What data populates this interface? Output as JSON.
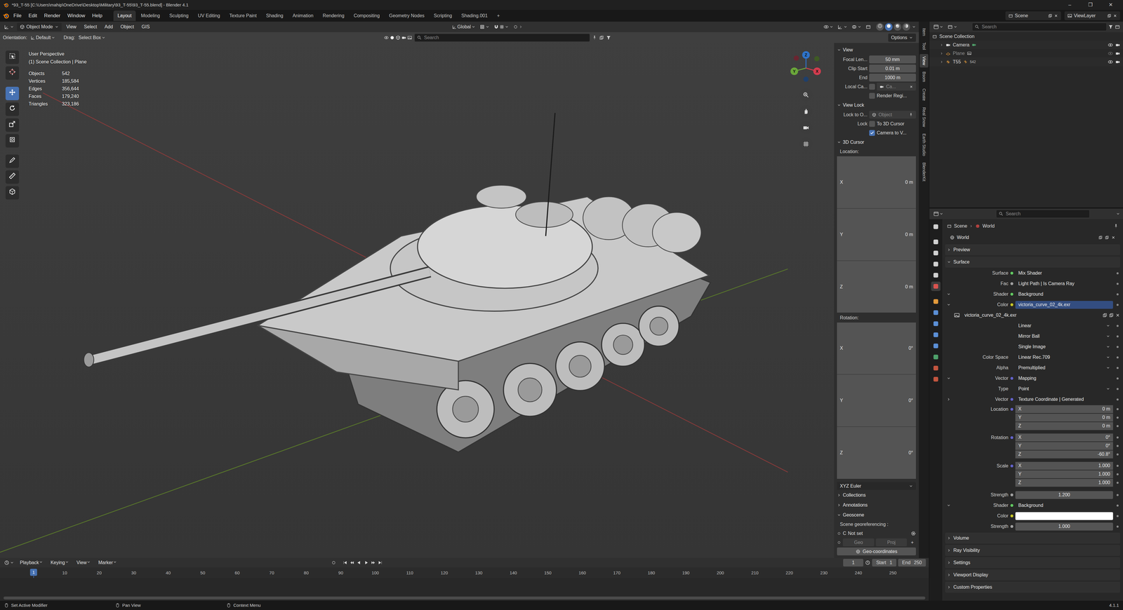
{
  "window": {
    "title": "*93_T-55 [C:\\Users\\mahip\\OneDrive\\Desktop\\Military\\93_T-55\\93_T-55.blend] - Blender 4.1",
    "controls": [
      "–",
      "❐",
      "✕"
    ]
  },
  "menu": [
    "File",
    "Edit",
    "Render",
    "Window",
    "Help"
  ],
  "workspaces": [
    {
      "label": "Layout",
      "selected": true
    },
    {
      "label": "Modeling",
      "selected": false
    },
    {
      "label": "Sculpting",
      "selected": false
    },
    {
      "label": "UV Editing",
      "selected": false
    },
    {
      "label": "Texture Paint",
      "selected": false
    },
    {
      "label": "Shading",
      "selected": false
    },
    {
      "label": "Animation",
      "selected": false
    },
    {
      "label": "Rendering",
      "selected": false
    },
    {
      "label": "Compositing",
      "selected": false
    },
    {
      "label": "Geometry Nodes",
      "selected": false
    },
    {
      "label": "Scripting",
      "selected": false
    },
    {
      "label": "Shading.001",
      "selected": false
    }
  ],
  "add_workspace": "+",
  "scene": {
    "label": "Scene"
  },
  "view_layer": {
    "label": "ViewLayer"
  },
  "viewport_header": {
    "mode": "Object Mode",
    "menus": [
      "View",
      "Select",
      "Add",
      "Object",
      "GIS"
    ],
    "orientation": "Global",
    "shading": [
      {
        "kind": "wireframe",
        "selected": false
      },
      {
        "kind": "solid",
        "selected": true
      },
      {
        "kind": "material",
        "selected": false
      },
      {
        "kind": "rendered",
        "selected": false
      }
    ]
  },
  "tool_settings": {
    "orientation_label": "Orientation:",
    "orientation": "Default",
    "drag_label": "Drag:",
    "drag": "Select Box",
    "search_placeholder": "Search",
    "options": "Options"
  },
  "tools": [
    {
      "kind": "select",
      "selected": false
    },
    {
      "kind": "cursor",
      "selected": false
    },
    {
      "kind": "move",
      "selected": true
    },
    {
      "kind": "rotate",
      "selected": false
    },
    {
      "kind": "scale",
      "selected": false
    },
    {
      "kind": "transform",
      "selected": false
    },
    {
      "kind": "annotate",
      "selected": false
    },
    {
      "kind": "measure",
      "selected": false
    },
    {
      "kind": "add-cube",
      "selected": false
    }
  ],
  "overlay": {
    "view": "User Perspective",
    "context": "(1) Scene Collection | Plane",
    "stats": [
      {
        "label": "Objects",
        "value": "542"
      },
      {
        "label": "Vertices",
        "value": "185,584"
      },
      {
        "label": "Edges",
        "value": "356,644"
      },
      {
        "label": "Faces",
        "value": "179,240"
      },
      {
        "label": "Triangles",
        "value": "323,186"
      }
    ]
  },
  "gizmo": [
    {
      "label": "Z",
      "color": "#2e73c9"
    },
    {
      "label": "Y",
      "color": "#6aa63a"
    },
    {
      "label": "X",
      "color": "#d23c4e"
    }
  ],
  "sidebar_tabs": [
    {
      "label": "Item",
      "selected": false
    },
    {
      "label": "Tool",
      "selected": false
    },
    {
      "label": "View",
      "selected": true
    },
    {
      "label": "Bsom",
      "selected": false
    },
    {
      "label": "Create",
      "selected": false
    },
    {
      "label": "Real Snow",
      "selected": false
    },
    {
      "label": "Earth Studio",
      "selected": false
    },
    {
      "label": "BlenderKit",
      "selected": false
    }
  ],
  "npanel": {
    "view": {
      "title": "View",
      "expanded": true,
      "fields": [
        {
          "label": "Focal Len...",
          "value": "50 mm"
        },
        {
          "label": "Clip Start",
          "value": "0.01 m"
        },
        {
          "label": "End",
          "value": "1000 m"
        }
      ],
      "local_camera": {
        "label": "Local Ca...",
        "checked": false,
        "value": "Ca..."
      },
      "render_region": {
        "label": "Render Regi...",
        "checked": false
      }
    },
    "view_lock": {
      "title": "View Lock",
      "expanded": true,
      "lock_to_label": "Lock to O...",
      "lock_to_placeholder": "Object",
      "lock_label": "Lock",
      "options": [
        {
          "label": "To 3D Cursor",
          "checked": false
        },
        {
          "label": "Camera to V...",
          "checked": true
        }
      ]
    },
    "cursor": {
      "title": "3D Cursor",
      "expanded": true,
      "location_label": "Location:",
      "location": [
        {
          "axis": "X",
          "value": "0 m"
        },
        {
          "axis": "Y",
          "value": "0 m"
        },
        {
          "axis": "Z",
          "value": "0 m"
        }
      ],
      "rotation_label": "Rotation:",
      "rotation": [
        {
          "axis": "X",
          "value": "0°"
        },
        {
          "axis": "Y",
          "value": "0°"
        },
        {
          "axis": "Z",
          "value": "0°"
        }
      ],
      "rotation_mode": "XYZ Euler"
    },
    "collapsed": [
      {
        "title": "Collections",
        "expanded": false
      },
      {
        "title": "Annotations",
        "expanded": false
      }
    ],
    "geoscene": {
      "title": "Geoscene",
      "expanded": true,
      "label": "Scene georeferencing :",
      "crs_prefix": "C",
      "crs": "Not set",
      "buttons": [
        {
          "label": "Geo",
          "disabled": true
        },
        {
          "label": "Proj",
          "disabled": true
        }
      ],
      "add": "+",
      "geo_button": "Geo-coordinates"
    }
  },
  "outliner": {
    "search_placeholder": "Search",
    "root": "Scene Collection",
    "items": [
      {
        "label": "Camera",
        "expanded": false,
        "hidden": false,
        "badge": ""
      },
      {
        "label": "Plane",
        "expanded": false,
        "hidden": true,
        "badge": ""
      },
      {
        "label": "T55",
        "expanded": false,
        "hidden": false,
        "badge": "542"
      }
    ]
  },
  "properties": {
    "search_placeholder": "Search",
    "tabs": [
      {
        "selected": false,
        "color": "#d0d0d0"
      },
      {
        "selected": false,
        "color": "#d0d0d0"
      },
      {
        "selected": false,
        "color": "#d0d0d0"
      },
      {
        "selected": false,
        "color": "#d0d0d0"
      },
      {
        "selected": false,
        "color": "#d0d0d0"
      },
      {
        "selected": true,
        "color": "#d9534f"
      },
      {
        "selected": false,
        "color": "#e39a3b"
      },
      {
        "selected": false,
        "color": "#5b8fd6"
      },
      {
        "selected": false,
        "color": "#5b8fd6"
      },
      {
        "selected": false,
        "color": "#5b8fd6"
      },
      {
        "selected": false,
        "color": "#5b8fd6"
      },
      {
        "selected": false,
        "color": "#4ea06a"
      },
      {
        "selected": false,
        "color": "#c2553f"
      },
      {
        "selected": false,
        "color": "#c2553f"
      }
    ],
    "breadcrumb": [
      "Scene",
      "World"
    ],
    "datablock": "World",
    "sections": [
      {
        "title": "Preview",
        "expanded": false
      },
      {
        "title": "Surface",
        "expanded": true,
        "rows": [
          {
            "kind": "socket",
            "label": "Surface",
            "value": "Mix Shader",
            "color": "#63c763",
            "highlighted": false
          },
          {
            "kind": "socket",
            "label": "Fac",
            "value": "Light Path | Is Camera Ray",
            "color": "#a1a1a1",
            "highlighted": false
          },
          {
            "kind": "socket",
            "label": "Shader",
            "value": "Background",
            "color": "#63c763",
            "highlighted": false,
            "expanded": true
          },
          {
            "kind": "socket",
            "label": "Color",
            "value": "victoria_curve_02_4k.exr",
            "color": "#c7c729",
            "highlighted": true,
            "expanded": true
          },
          {
            "kind": "image",
            "value": "victoria_curve_02_4k.exr"
          },
          {
            "kind": "dropdown",
            "value": "Linear"
          },
          {
            "kind": "dropdown",
            "value": "Mirror Ball"
          },
          {
            "kind": "dropdown",
            "value": "Single Image"
          },
          {
            "kind": "dropdown",
            "label": "Color Space",
            "value": "Linear Rec.709"
          },
          {
            "kind": "dropdown",
            "label": "Alpha",
            "value": "Premultiplied"
          },
          {
            "kind": "socket",
            "label": "Vector",
            "value": "Mapping",
            "color": "#6363c7",
            "highlighted": false,
            "expanded": true
          },
          {
            "kind": "dropdown",
            "label": "Type",
            "value": "Point"
          },
          {
            "kind": "socket",
            "label": "Vector",
            "value": "Texture Coordinate | Generated",
            "color": "#6363c7",
            "highlighted": false,
            "expanded": false
          },
          {
            "kind": "vector",
            "label": "Location",
            "color": "#6363c7",
            "values": [
              {
                "axis": "X",
                "value": "0 m"
              },
              {
                "axis": "Y",
                "value": "0 m"
              },
              {
                "axis": "Z",
                "value": "0 m"
              }
            ]
          },
          {
            "kind": "vector",
            "label": "Rotation",
            "color": "#6363c7",
            "values": [
              {
                "axis": "X",
                "value": "0°"
              },
              {
                "axis": "Y",
                "value": "0°"
              },
              {
                "axis": "Z",
                "value": "-60.8°"
              }
            ]
          },
          {
            "kind": "vector",
            "label": "Scale",
            "color": "#6363c7",
            "values": [
              {
                "axis": "X",
                "value": "1.000"
              },
              {
                "axis": "Y",
                "value": "1.000"
              },
              {
                "axis": "Z",
                "value": "1.000"
              }
            ]
          },
          {
            "kind": "number",
            "label": "Strength",
            "value": "1.200",
            "color": "#a1a1a1"
          },
          {
            "kind": "socket",
            "label": "Shader",
            "value": "Background",
            "color": "#63c763",
            "highlighted": false,
            "expanded": true
          },
          {
            "kind": "color",
            "label": "Color",
            "color": "#c7c729",
            "value_color": "#ffffff"
          },
          {
            "kind": "number",
            "label": "Strength",
            "value": "1.000",
            "color": "#a1a1a1"
          }
        ]
      },
      {
        "title": "Volume",
        "expanded": false
      },
      {
        "title": "Ray Visibility",
        "expanded": false
      },
      {
        "title": "Settings",
        "expanded": false
      },
      {
        "title": "Viewport Display",
        "expanded": false
      },
      {
        "title": "Custom Properties",
        "expanded": false
      }
    ]
  },
  "timeline": {
    "menus": [
      "Playback",
      "Keying",
      "View",
      "Marker"
    ],
    "current_frame": "1",
    "start_label": "Start",
    "start": "1",
    "end_label": "End",
    "end": "250",
    "ruler": [
      "10",
      "20",
      "30",
      "40",
      "50",
      "60",
      "70",
      "80",
      "90",
      "100",
      "110",
      "120",
      "130",
      "140",
      "150",
      "160",
      "170",
      "180",
      "190",
      "200",
      "210",
      "220",
      "230",
      "240",
      "250"
    ]
  },
  "status_bar": {
    "items": [
      "Set Active Modifier",
      "Pan View",
      "Context Menu"
    ],
    "version": "4.1.1"
  }
}
